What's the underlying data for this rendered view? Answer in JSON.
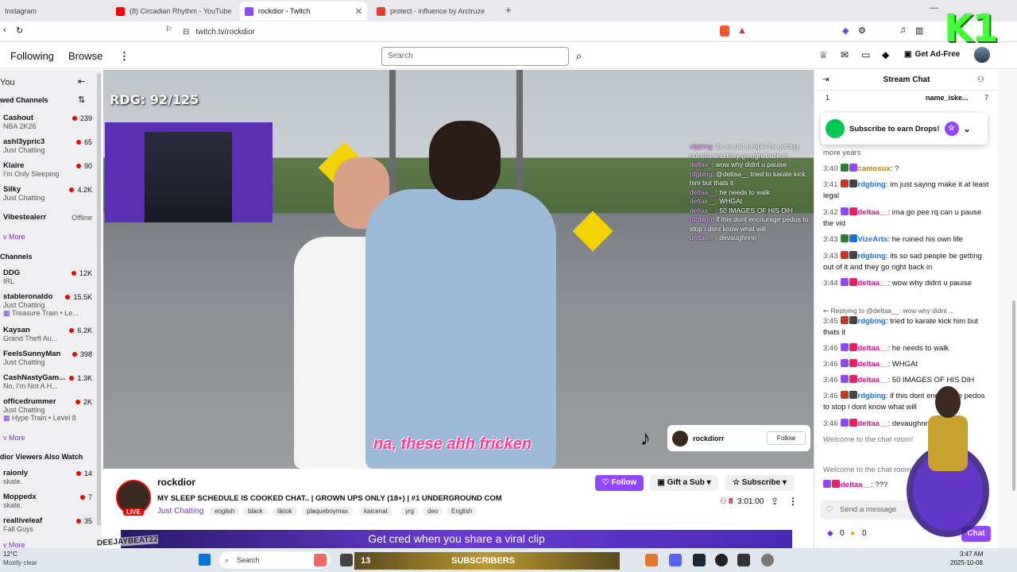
{
  "browser": {
    "tabs": [
      {
        "label": "Instagram",
        "icon": "instagram-icon"
      },
      {
        "label": "(8) Circadian Rhythm - YouTube",
        "icon": "youtube-icon"
      },
      {
        "label": "rockdior - Twitch",
        "icon": "twitch-icon",
        "active": true
      },
      {
        "label": "protect - influence by Arctruze",
        "icon": "music-icon"
      }
    ],
    "url": "twitch.tv/rockdior"
  },
  "twitch": {
    "nav": {
      "following": "Following",
      "browse": "Browse",
      "search_placeholder": "Search",
      "ad_free": "Get Ad-Free"
    },
    "sidebar": {
      "for_you": "You",
      "followed_header": "wed Channels",
      "followed": [
        {
          "name": "Cashout",
          "game": "NBA 2K26",
          "viewers": "239"
        },
        {
          "name": "ashl3ypric3",
          "game": "Just Chatting",
          "viewers": "65"
        },
        {
          "name": "Klaire",
          "game": "I'm Only Sleeping",
          "viewers": "90"
        },
        {
          "name": "Silky",
          "game": "Just Chatting",
          "viewers": "4.2K"
        },
        {
          "name": "Vibestealerr",
          "game": "",
          "viewers": "Offline"
        }
      ],
      "show_more_1": "v More",
      "live_header": "Channels",
      "live": [
        {
          "name": "DDG",
          "game": "IRL",
          "viewers": "12K"
        },
        {
          "name": "stableronaldo",
          "game": "Just Chatting",
          "extra": "Treasure Train • Le...",
          "viewers": "15.5K"
        },
        {
          "name": "Kaysan",
          "game": "Grand Theft Au...",
          "viewers": "6.2K"
        },
        {
          "name": "FeelsSunnyMan",
          "game": "Just Chatting",
          "viewers": "398"
        },
        {
          "name": "CashNastyGam...",
          "game": "No, I'm Not A H...",
          "viewers": "1.3K"
        },
        {
          "name": "officedrummer",
          "game": "Just Chatting",
          "extra": "Hype Train • Level 8",
          "viewers": "2K"
        }
      ],
      "show_more_2": "v More",
      "also_watch_header": "dior Viewers Also Watch",
      "also_watch": [
        {
          "name": "raionly",
          "game": "skate.",
          "viewers": "14"
        },
        {
          "name": "Moppedx",
          "game": "skate.",
          "viewers": "7"
        },
        {
          "name": "realliveleaf",
          "game": "Fall Guys",
          "viewers": "35"
        }
      ],
      "show_more_3": "v More"
    },
    "video": {
      "rdg_counter": "RDG: 92/125",
      "overlay_chat": [
        {
          "user": "rdgbing",
          "text": ": its so sad people be getting out of it and they go right back in"
        },
        {
          "user": "deltaa_",
          "text": ": wow why didnt u pauise"
        },
        {
          "user": "rdgbing",
          "text": ": @deltaa__ tried to karate kick him but thats it"
        },
        {
          "user": "deltaa__",
          "text": ": he needs to walk"
        },
        {
          "user": "deltaa__",
          "text": ": WHGAt"
        },
        {
          "user": "deltaa__",
          "text": ": 50 IMAGES OF HIS DIH"
        },
        {
          "user": "rdgbing",
          "text": ": if this dont encourage pedos to stop i dont know what will"
        },
        {
          "user": "deltaa__",
          "text": ": devaughnnn"
        }
      ],
      "subtitle": "na, these ahh fricken",
      "tiktok_user": "rockdiorr",
      "tiktok_follow": "Follow"
    },
    "stream": {
      "channel": "rockdior",
      "live_badge": "LIVE",
      "title": "MY SLEEP SCHEDULE IS COOKED CHAT.. | GROWN UPS ONLY (18+) | #1 UNDERGROUND COM",
      "category": "Just Chatting",
      "tags": [
        "english",
        "black",
        "tiktok",
        "plaqueboymax",
        "kaicenat",
        "yrg",
        "deo",
        "English"
      ],
      "follow": "Follow",
      "gift": "Gift a Sub",
      "subscribe": "Subscribe",
      "viewers": "8",
      "uptime": "3:01:00",
      "banner": "Get cred when you share a viral clip"
    },
    "chat": {
      "header": "Stream Chat",
      "top_counts": [
        "1",
        "name_iske...",
        "7"
      ],
      "drops": "Subscribe to earn Drops!",
      "partial": "more years",
      "messages": [
        {
          "time": "3:40",
          "user": "camosux",
          "color": "#b8860b",
          "text": ": ?"
        },
        {
          "time": "3:41",
          "user": "rdgbing",
          "color": "#1e6fd9",
          "text": ": im just saying make it at least legal"
        },
        {
          "time": "3:42",
          "user": "deltaa__",
          "color": "#c0188c",
          "text": ": ima go pee rq can u pause the vid"
        },
        {
          "time": "3:43",
          "user": "VizeArts",
          "color": "#1e6fd9",
          "text": ": he ruined his own life"
        },
        {
          "time": "3:43",
          "user": "rdgbing",
          "color": "#1e6fd9",
          "text": ": its so sad people be getting out of it and they go right back in"
        },
        {
          "time": "3:44",
          "user": "deltaa__",
          "color": "#c0188c",
          "text": ": wow why didnt u pauise"
        },
        {
          "time": "3:45",
          "user": "rdgbing",
          "color": "#1e6fd9",
          "text": ": tried to karate kick him but thats it",
          "reply": "Replying to @deltaa__: wow why didnt ..."
        },
        {
          "time": "3:46",
          "user": "deltaa__",
          "color": "#c0188c",
          "text": ": he needs to walk"
        },
        {
          "time": "3:46",
          "user": "deltaa__",
          "color": "#c0188c",
          "text": ": WHGAt"
        },
        {
          "time": "3:46",
          "user": "deltaa__",
          "color": "#c0188c",
          "text": ": 50 IMAGES OF HIS DIH"
        },
        {
          "time": "3:46",
          "user": "rdgbing",
          "color": "#1e6fd9",
          "text": ": if this dont encourage pedos to stop i dont know what will"
        },
        {
          "time": "3:46",
          "user": "deltaa__",
          "color": "#c0188c",
          "text": ": devaughnnn"
        }
      ],
      "welcome1": "Welcome to the chat room!",
      "welcome2": "Welcome to the chat room!",
      "pinned_user": "deltaa__",
      "pinned_text": ": ???",
      "input_placeholder": "Send a message",
      "points": "0",
      "bits": "0",
      "chat_button": "Chat"
    }
  },
  "taskbar": {
    "weather_temp": "12°C",
    "weather_desc": "Mostly clear",
    "search": "Search",
    "subs_count": "13",
    "subs_label": "SUBSCRIBERS",
    "time": "3:47 AM",
    "date": "2025-10-08"
  },
  "overlay": {
    "logo": "K1",
    "streamer_tag": "DEEJAYBEAT22"
  },
  "colors": {
    "accent": "#9147ff",
    "live": "#eb0400"
  }
}
